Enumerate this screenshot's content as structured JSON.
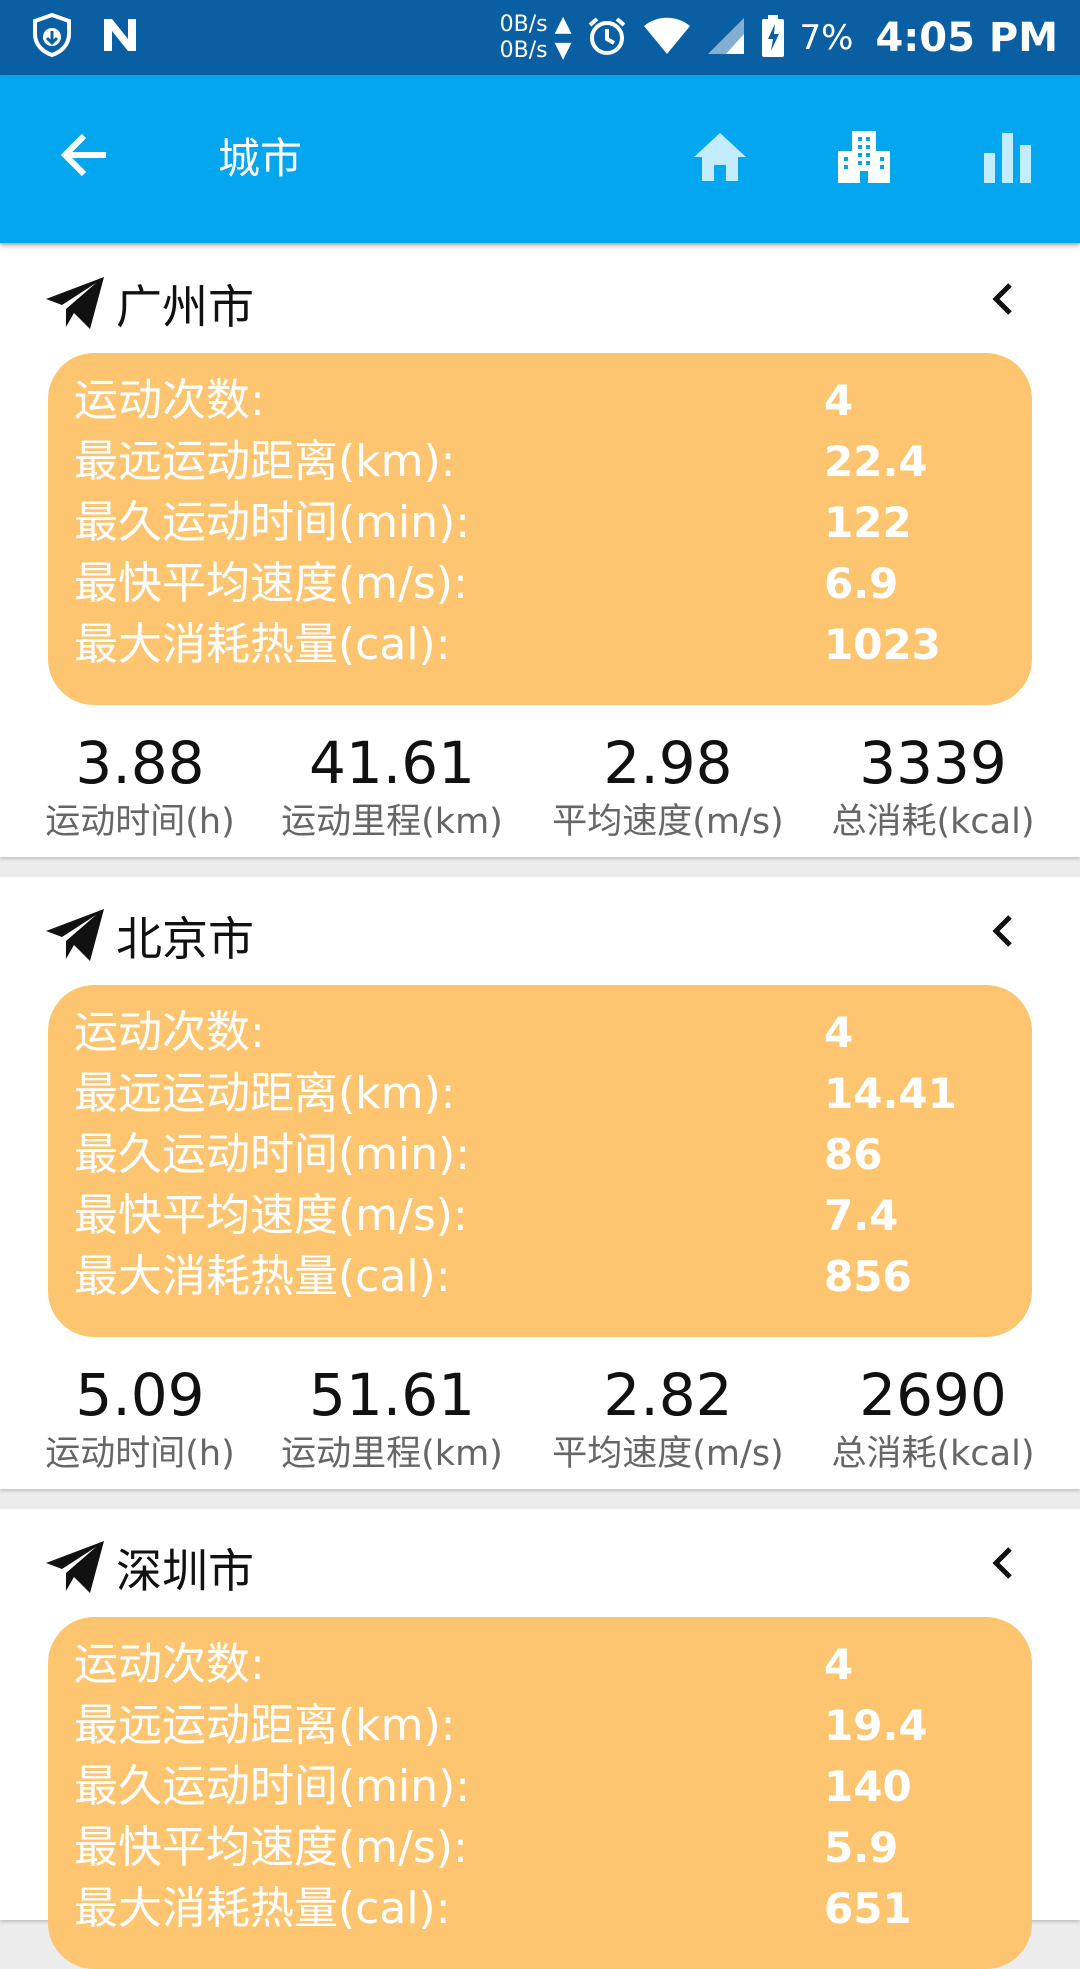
{
  "status_bar": {
    "net_up": "0B/s",
    "net_down": "0B/s",
    "battery": "7%",
    "time": "4:05 PM",
    "icons": [
      "shield-icon",
      "n-icon",
      "alarm-icon",
      "wifi-icon",
      "cell-signal-icon",
      "battery-charging-icon"
    ]
  },
  "app_bar": {
    "title": "城市",
    "actions": [
      "home-icon",
      "city-icon",
      "bar-chart-icon"
    ],
    "colors": {
      "app_bar": "#04a6f0",
      "status_bar": "#0a5fa3",
      "panel": "#fec571"
    }
  },
  "cities": [
    {
      "name": "广州市",
      "details": [
        {
          "label": "运动次数:",
          "value": "4"
        },
        {
          "label": "最远运动距离(km):",
          "value": "22.4"
        },
        {
          "label": "最久运动时间(min):",
          "value": "122"
        },
        {
          "label": "最快平均速度(m/s):",
          "value": "6.9"
        },
        {
          "label": "最大消耗热量(cal):",
          "value": "1023"
        }
      ],
      "stats": [
        {
          "value": "3.88",
          "label": "运动时间(h)"
        },
        {
          "value": "41.61",
          "label": "运动里程(km)"
        },
        {
          "value": "2.98",
          "label": "平均速度(m/s)"
        },
        {
          "value": "3339",
          "label": "总消耗(kcal)"
        }
      ]
    },
    {
      "name": "北京市",
      "details": [
        {
          "label": "运动次数:",
          "value": "4"
        },
        {
          "label": "最远运动距离(km):",
          "value": "14.41"
        },
        {
          "label": "最久运动时间(min):",
          "value": "86"
        },
        {
          "label": "最快平均速度(m/s):",
          "value": "7.4"
        },
        {
          "label": "最大消耗热量(cal):",
          "value": "856"
        }
      ],
      "stats": [
        {
          "value": "5.09",
          "label": "运动时间(h)"
        },
        {
          "value": "51.61",
          "label": "运动里程(km)"
        },
        {
          "value": "2.82",
          "label": "平均速度(m/s)"
        },
        {
          "value": "2690",
          "label": "总消耗(kcal)"
        }
      ]
    },
    {
      "name": "深圳市",
      "details": [
        {
          "label": "运动次数:",
          "value": "4"
        },
        {
          "label": "最远运动距离(km):",
          "value": "19.4"
        },
        {
          "label": "最久运动时间(min):",
          "value": "140"
        },
        {
          "label": "最快平均速度(m/s):",
          "value": "5.9"
        },
        {
          "label": "最大消耗热量(cal):",
          "value": "651"
        }
      ],
      "stats": []
    }
  ]
}
